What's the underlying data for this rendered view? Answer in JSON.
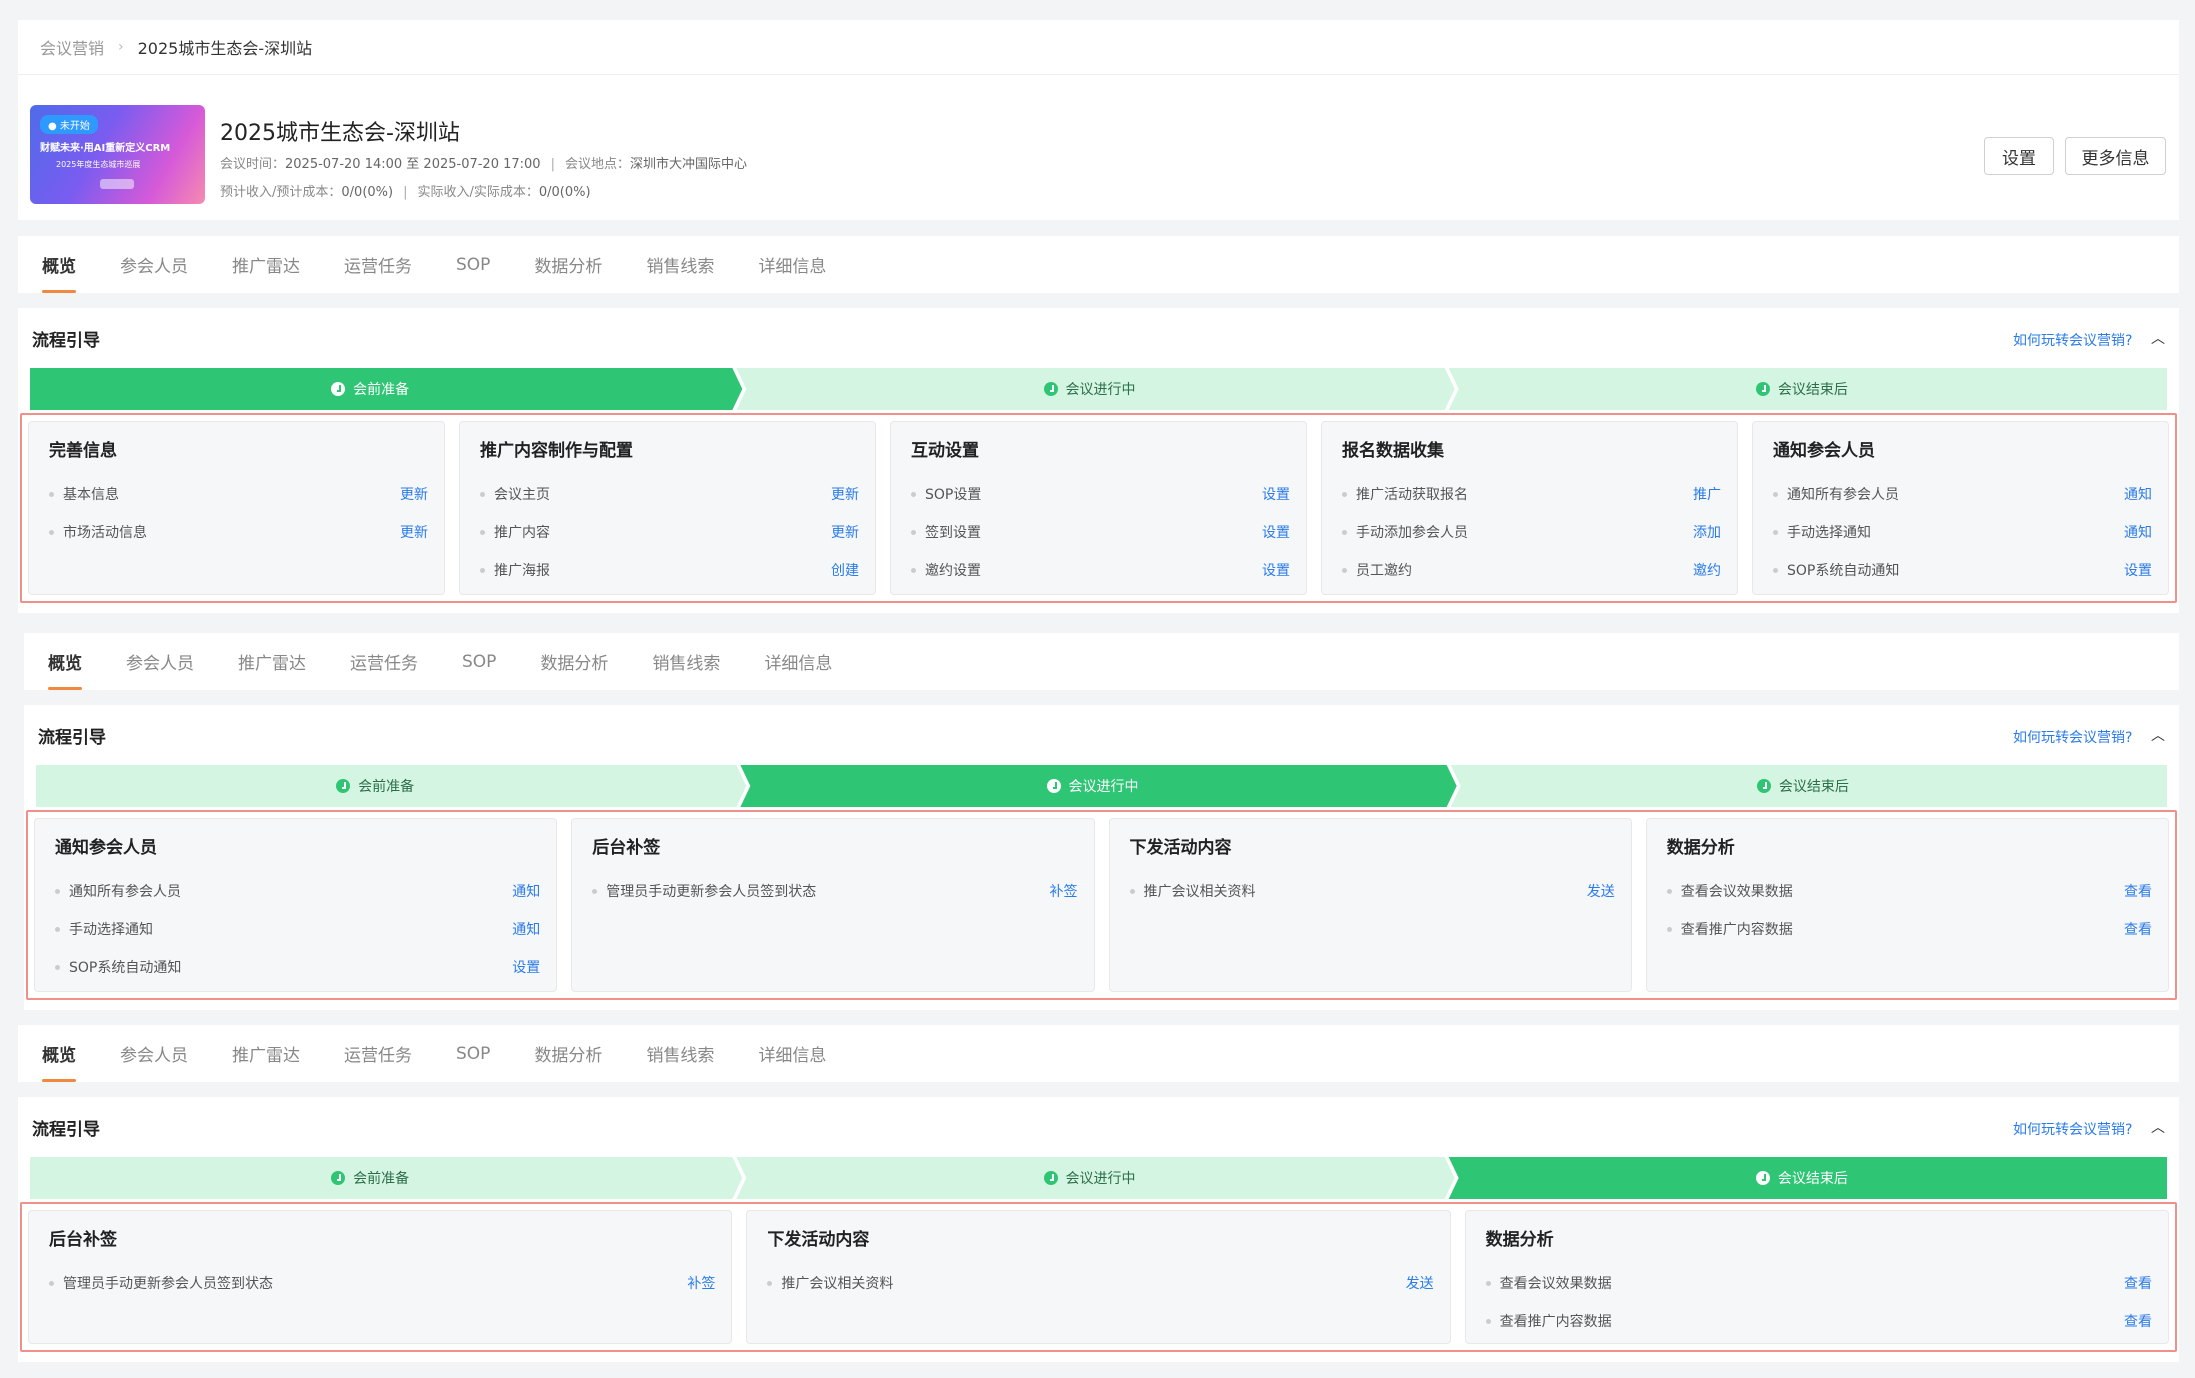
{
  "breadcrumb": {
    "parent": "会议营销",
    "current": "2025城市生态会-深圳站"
  },
  "header": {
    "banner": {
      "status": "● 未开始",
      "line1": "财赋未来·用AI重新定义CRM",
      "line2": "2025年度生态城市巡展"
    },
    "title": "2025城市生态会-深圳站",
    "time_label": "会议时间：",
    "time_value": "2025-07-20 14:00 至 2025-07-20 17:00",
    "location_label": "会议地点：",
    "location_value": "深圳市大冲国际中心",
    "expected_label": "预计收入/预计成本：",
    "expected_value": "0/0(0%)",
    "actual_label": "实际收入/实际成本：",
    "actual_value": "0/0(0%)",
    "sep": "|",
    "settings_button": "设置",
    "more_button": "更多信息"
  },
  "tabs": [
    "概览",
    "参会人员",
    "推广雷达",
    "运营任务",
    "SOP",
    "数据分析",
    "销售线索",
    "详细信息"
  ],
  "flow_title": "流程引导",
  "flow_help": "如何玩转会议营销?",
  "chevron": "︿",
  "steps": [
    "会前准备",
    "会议进行中",
    "会议结束后"
  ],
  "colors": {
    "active_step": "#2ec574",
    "inactive_step": "#d5f5e3",
    "link": "#2b7ce9",
    "highlight_border": "#f0908a"
  },
  "sections": [
    {
      "active_step": 0,
      "cards": [
        {
          "title": "完善信息",
          "rows": [
            {
              "label": "基本信息",
              "action": "更新"
            },
            {
              "label": "市场活动信息",
              "action": "更新"
            }
          ]
        },
        {
          "title": "推广内容制作与配置",
          "rows": [
            {
              "label": "会议主页",
              "action": "更新"
            },
            {
              "label": "推广内容",
              "action": "更新"
            },
            {
              "label": "推广海报",
              "action": "创建"
            }
          ]
        },
        {
          "title": "互动设置",
          "rows": [
            {
              "label": "SOP设置",
              "action": "设置"
            },
            {
              "label": "签到设置",
              "action": "设置"
            },
            {
              "label": "邀约设置",
              "action": "设置"
            }
          ]
        },
        {
          "title": "报名数据收集",
          "rows": [
            {
              "label": "推广活动获取报名",
              "action": "推广"
            },
            {
              "label": "手动添加参会人员",
              "action": "添加"
            },
            {
              "label": "员工邀约",
              "action": "邀约"
            }
          ]
        },
        {
          "title": "通知参会人员",
          "rows": [
            {
              "label": "通知所有参会人员",
              "action": "通知"
            },
            {
              "label": "手动选择通知",
              "action": "通知"
            },
            {
              "label": "SOP系统自动通知",
              "action": "设置"
            }
          ]
        }
      ]
    },
    {
      "active_step": 1,
      "cards": [
        {
          "title": "通知参会人员",
          "rows": [
            {
              "label": "通知所有参会人员",
              "action": "通知"
            },
            {
              "label": "手动选择通知",
              "action": "通知"
            },
            {
              "label": "SOP系统自动通知",
              "action": "设置"
            }
          ]
        },
        {
          "title": "后台补签",
          "rows": [
            {
              "label": "管理员手动更新参会人员签到状态",
              "action": "补签"
            }
          ]
        },
        {
          "title": "下发活动内容",
          "rows": [
            {
              "label": "推广会议相关资料",
              "action": "发送"
            }
          ]
        },
        {
          "title": "数据分析",
          "rows": [
            {
              "label": "查看会议效果数据",
              "action": "查看"
            },
            {
              "label": "查看推广内容数据",
              "action": "查看"
            }
          ]
        }
      ]
    },
    {
      "active_step": 2,
      "cards": [
        {
          "title": "后台补签",
          "rows": [
            {
              "label": "管理员手动更新参会人员签到状态",
              "action": "补签"
            }
          ]
        },
        {
          "title": "下发活动内容",
          "rows": [
            {
              "label": "推广会议相关资料",
              "action": "发送"
            }
          ]
        },
        {
          "title": "数据分析",
          "rows": [
            {
              "label": "查看会议效果数据",
              "action": "查看"
            },
            {
              "label": "查看推广内容数据",
              "action": "查看"
            }
          ]
        }
      ]
    }
  ]
}
